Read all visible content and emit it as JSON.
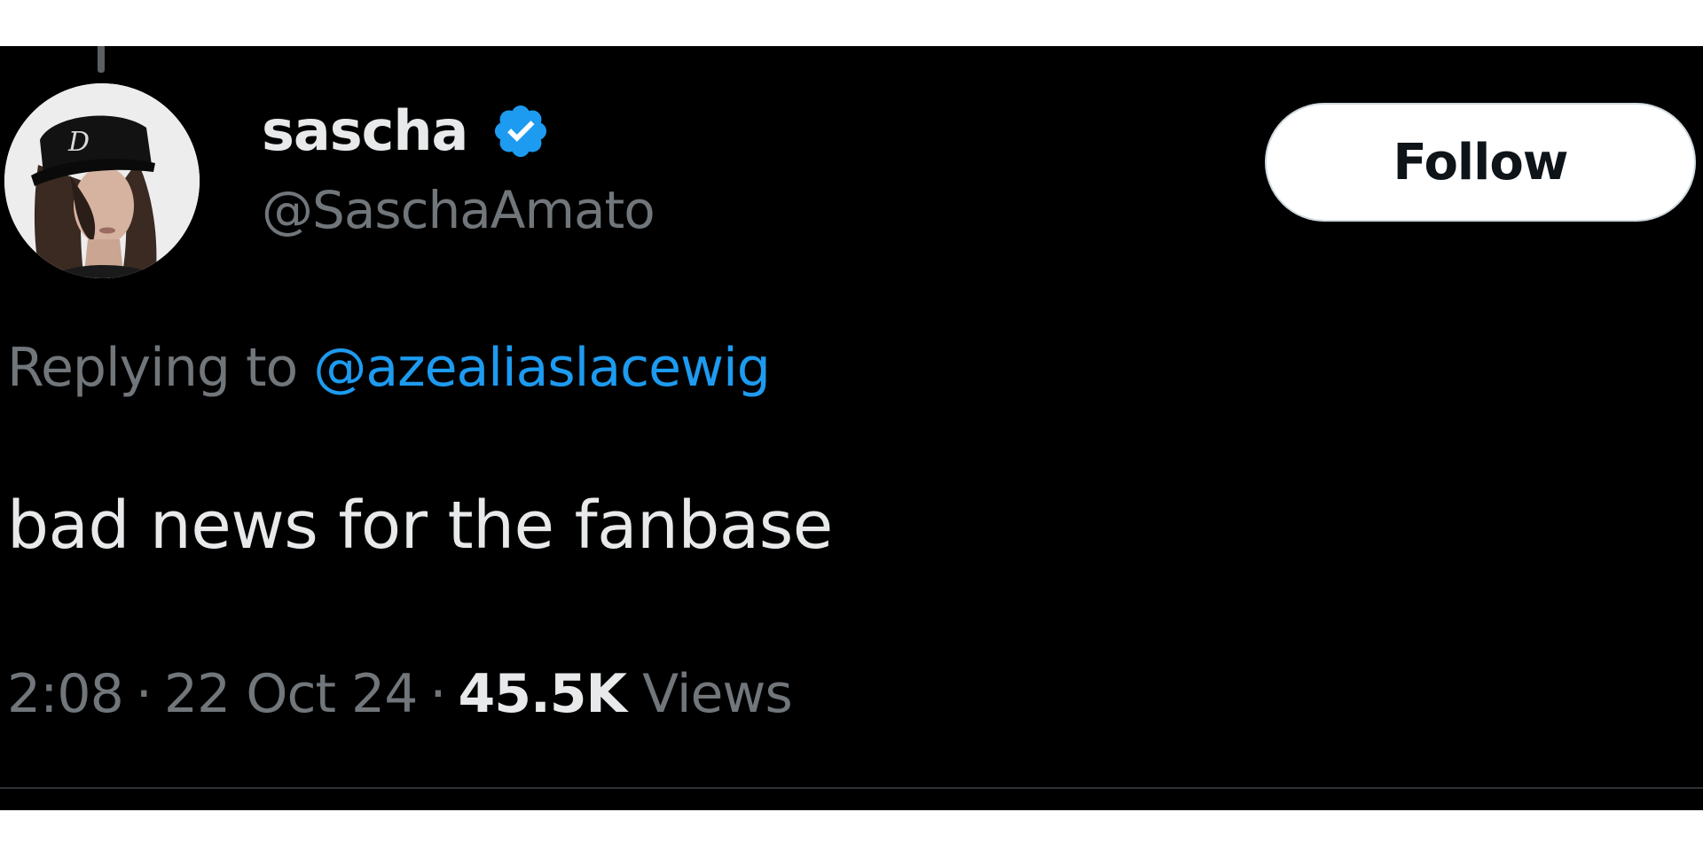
{
  "tweet": {
    "author": {
      "display_name": "sascha",
      "handle": "@SaschaAmato",
      "verified": true,
      "avatar_icon": "profile-photo-avatar"
    },
    "follow_label": "Follow",
    "reply": {
      "prefix": "Replying to",
      "mention": "@azealiaslacewig"
    },
    "text": "bad news for the fanbase",
    "meta": {
      "time": "2:08",
      "date": "22 Oct 24",
      "views_count": "45.5K",
      "views_label": "Views",
      "separator": "·"
    }
  },
  "colors": {
    "background": "#000000",
    "primary_text": "#e7e9ea",
    "secondary_text": "#71767b",
    "link": "#1d9bf0",
    "verified_badge": "#1d9bf0",
    "follow_button_bg": "#ffffff",
    "follow_button_text": "#0f1419"
  }
}
